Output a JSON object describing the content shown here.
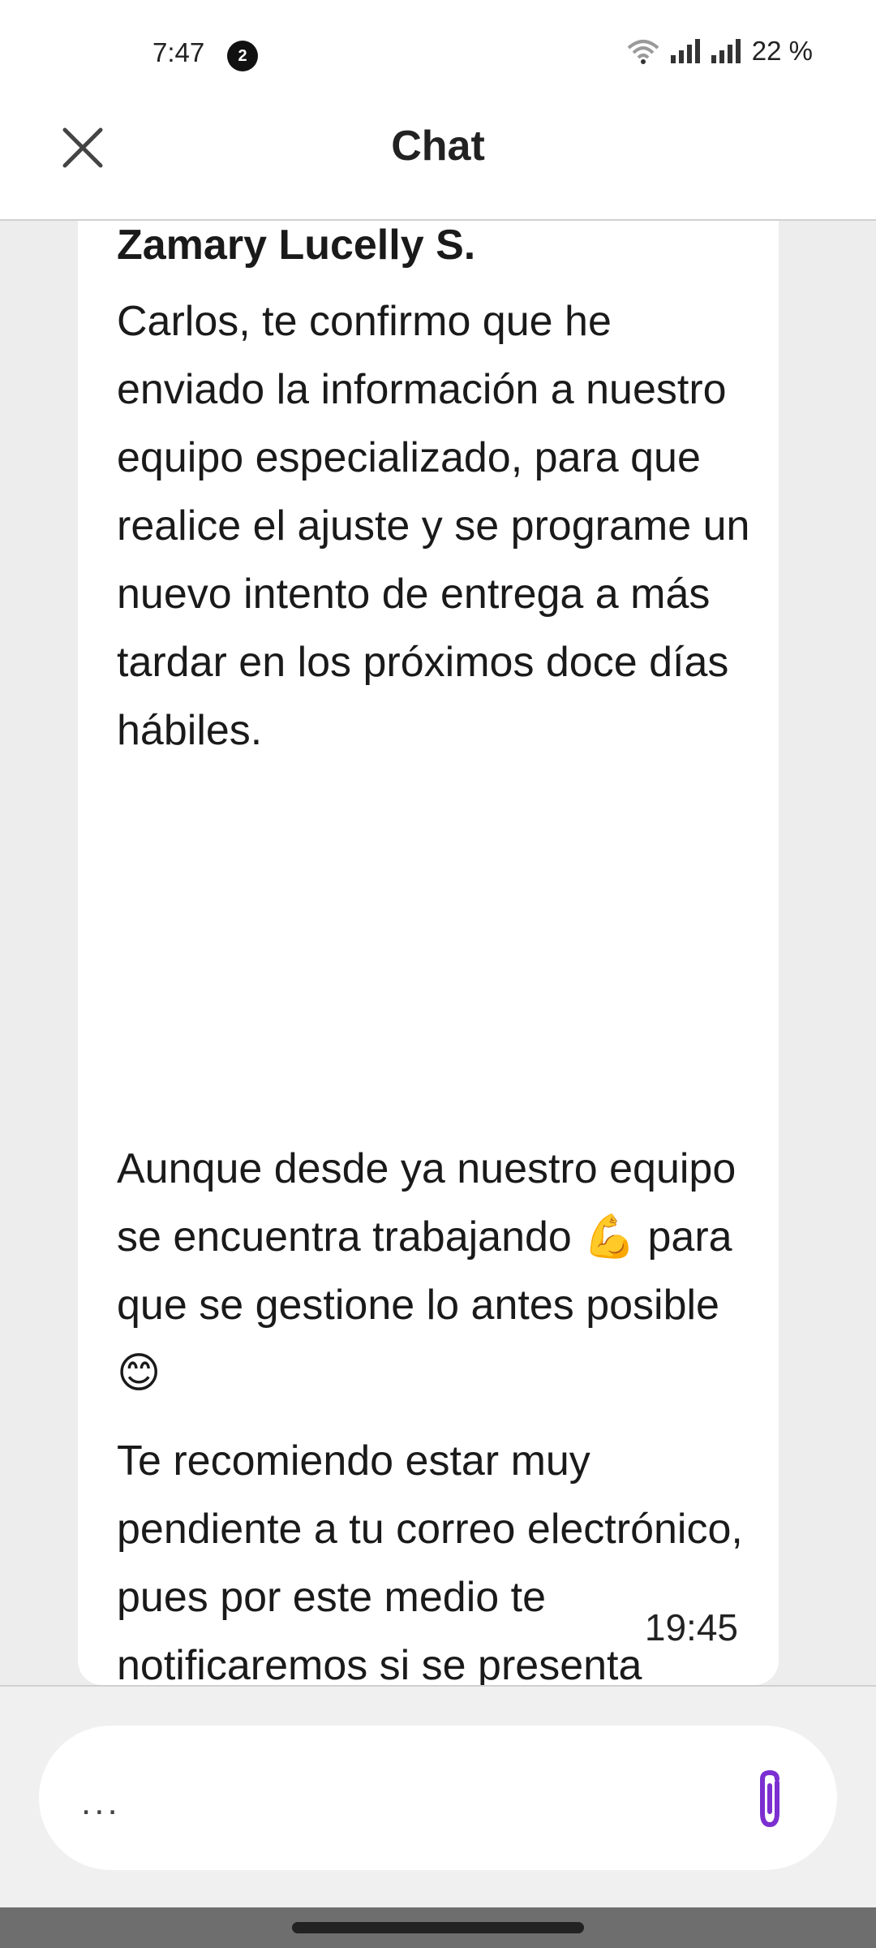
{
  "status_bar": {
    "time": "7:47",
    "notification_count": "2",
    "battery": "22 %"
  },
  "header": {
    "title": "Chat",
    "close_icon": "close-icon"
  },
  "message": {
    "sender": "Zamary Lucelly S.",
    "paragraphs": [
      "Carlos, te confirmo que he enviado la información a nuestro equipo especializado, para que realice el ajuste y se programe un nuevo intento de entrega a más tardar en los próximos doce días hábiles.",
      "Aunque desde ya nuestro equipo se encuentra trabajando 💪 para que se gestione lo antes posible 😊",
      "Te recomiendo estar muy pendiente a tu correo electrónico, pues por este medio te notificaremos si se presenta alguna novedad con la entrega."
    ],
    "time": "19:45"
  },
  "composer": {
    "placeholder": "...",
    "attach_icon": "paperclip-icon"
  },
  "colors": {
    "accent": "#7b2fd0",
    "background": "#ededed",
    "bubble": "#ffffff"
  }
}
